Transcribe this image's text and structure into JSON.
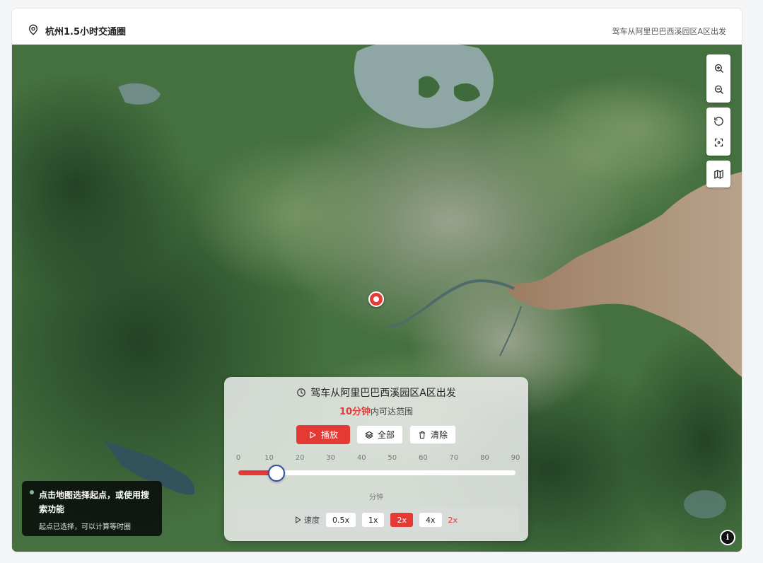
{
  "header": {
    "title": "杭州1.5小时交通圈",
    "subtitle": "驾车从阿里巴巴西溪园区A区出发",
    "pin_icon": "map-pin-icon"
  },
  "map": {
    "marker": {
      "label": "origin-marker"
    },
    "controls": [
      {
        "name": "zoom-in-button",
        "icon": "zoom-in-icon"
      },
      {
        "name": "zoom-out-button",
        "icon": "zoom-out-icon"
      },
      {
        "name": "reset-button",
        "icon": "reset-icon"
      },
      {
        "name": "locate-button",
        "icon": "locate-icon"
      },
      {
        "name": "map-layer-button",
        "icon": "map-icon"
      }
    ]
  },
  "panel": {
    "title": "驾车从阿里巴巴西溪园区A区出发",
    "range_highlight": "10分钟",
    "range_suffix": "内可达范围",
    "buttons": {
      "play": "播放",
      "all": "全部",
      "clear": "清除"
    },
    "slider": {
      "ticks": [
        "0",
        "10",
        "20",
        "30",
        "40",
        "50",
        "60",
        "70",
        "80",
        "90"
      ],
      "value": 10,
      "min": 0,
      "max": 90,
      "unit": "分钟"
    },
    "speed": {
      "label": "速度",
      "options": [
        "0.5x",
        "1x",
        "2x",
        "4x"
      ],
      "selected": "2x",
      "current": "2x"
    }
  },
  "tip": {
    "main": "点击地图选择起点，或使用搜索功能",
    "sub": "起点已选择，可以计算等时圈"
  },
  "colors": {
    "accent": "#e53935",
    "slider_thumb_border": "#2f4ea3"
  }
}
